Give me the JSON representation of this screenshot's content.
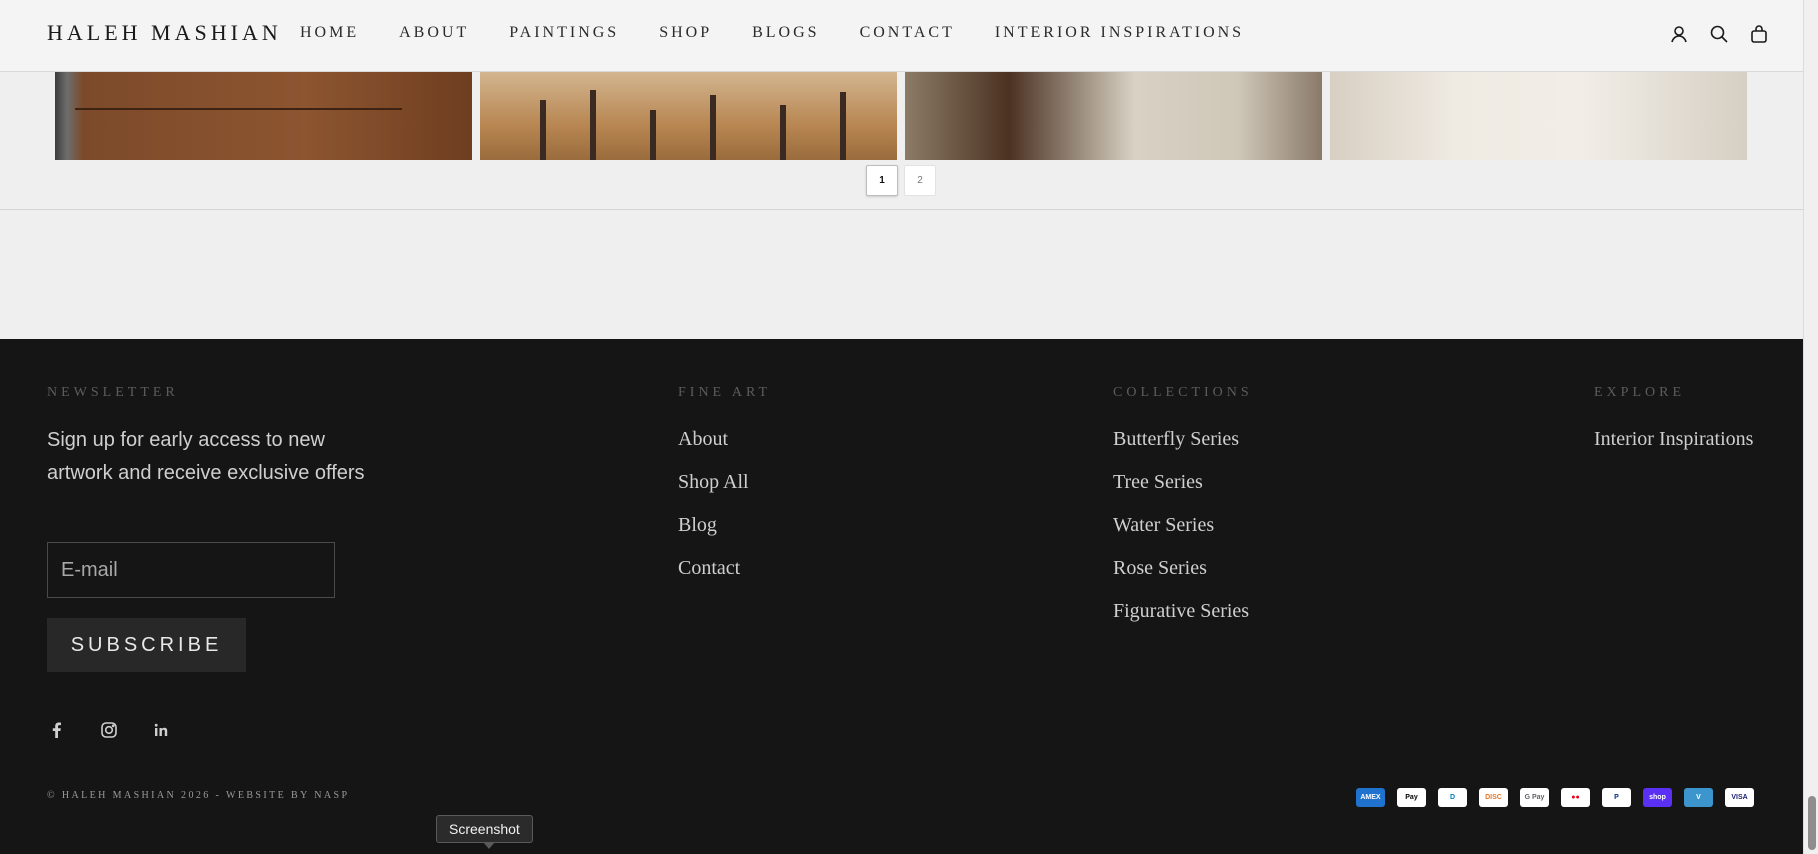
{
  "header": {
    "logo": "HALEH MASHIAN",
    "nav": [
      "HOME",
      "ABOUT",
      "PAINTINGS",
      "SHOP",
      "BLOGS",
      "CONTACT",
      "INTERIOR INSPIRATIONS"
    ],
    "icons": [
      "account-icon",
      "search-icon",
      "cart-icon"
    ]
  },
  "pagination": {
    "pages": [
      "1",
      "2"
    ],
    "current": "1"
  },
  "footer": {
    "newsletter": {
      "title": "NEWSLETTER",
      "text": "Sign up for early access to new artwork and receive exclusive offers",
      "email_placeholder": "E-mail",
      "subscribe_label": "SUBSCRIBE"
    },
    "fine_art": {
      "title": "FINE ART",
      "links": [
        "About",
        "Shop All",
        "Blog",
        "Contact"
      ]
    },
    "collections": {
      "title": "COLLECTIONS",
      "links": [
        "Butterfly Series",
        "Tree Series",
        "Water Series",
        "Rose Series",
        "Figurative Series"
      ]
    },
    "explore": {
      "title": "EXPLORE",
      "links": [
        "Interior Inspirations"
      ]
    },
    "socials": [
      "facebook-icon",
      "instagram-icon",
      "linkedin-icon"
    ],
    "copyright": "© HALEH MASHIAN 2026 - WEBSITE BY NASP",
    "payments": [
      {
        "name": "amex",
        "label": "AMEX",
        "bg": "#1f72cd",
        "fg": "#ffffff"
      },
      {
        "name": "apple-pay",
        "label": "Pay",
        "bg": "#ffffff",
        "fg": "#000000"
      },
      {
        "name": "diners",
        "label": "D",
        "bg": "#ffffff",
        "fg": "#0079be"
      },
      {
        "name": "discover",
        "label": "DISC",
        "bg": "#ffffff",
        "fg": "#e8752a"
      },
      {
        "name": "google-pay",
        "label": "G Pay",
        "bg": "#ffffff",
        "fg": "#5f6368"
      },
      {
        "name": "mastercard",
        "label": "●●",
        "bg": "#ffffff",
        "fg": "#eb001b"
      },
      {
        "name": "paypal",
        "label": "P",
        "bg": "#ffffff",
        "fg": "#003087"
      },
      {
        "name": "shop-pay",
        "label": "shop",
        "bg": "#5a31f4",
        "fg": "#ffffff"
      },
      {
        "name": "venmo",
        "label": "V",
        "bg": "#3d95ce",
        "fg": "#ffffff"
      },
      {
        "name": "visa",
        "label": "VISA",
        "bg": "#ffffff",
        "fg": "#1a1f71"
      }
    ]
  },
  "tooltip": "Screenshot"
}
